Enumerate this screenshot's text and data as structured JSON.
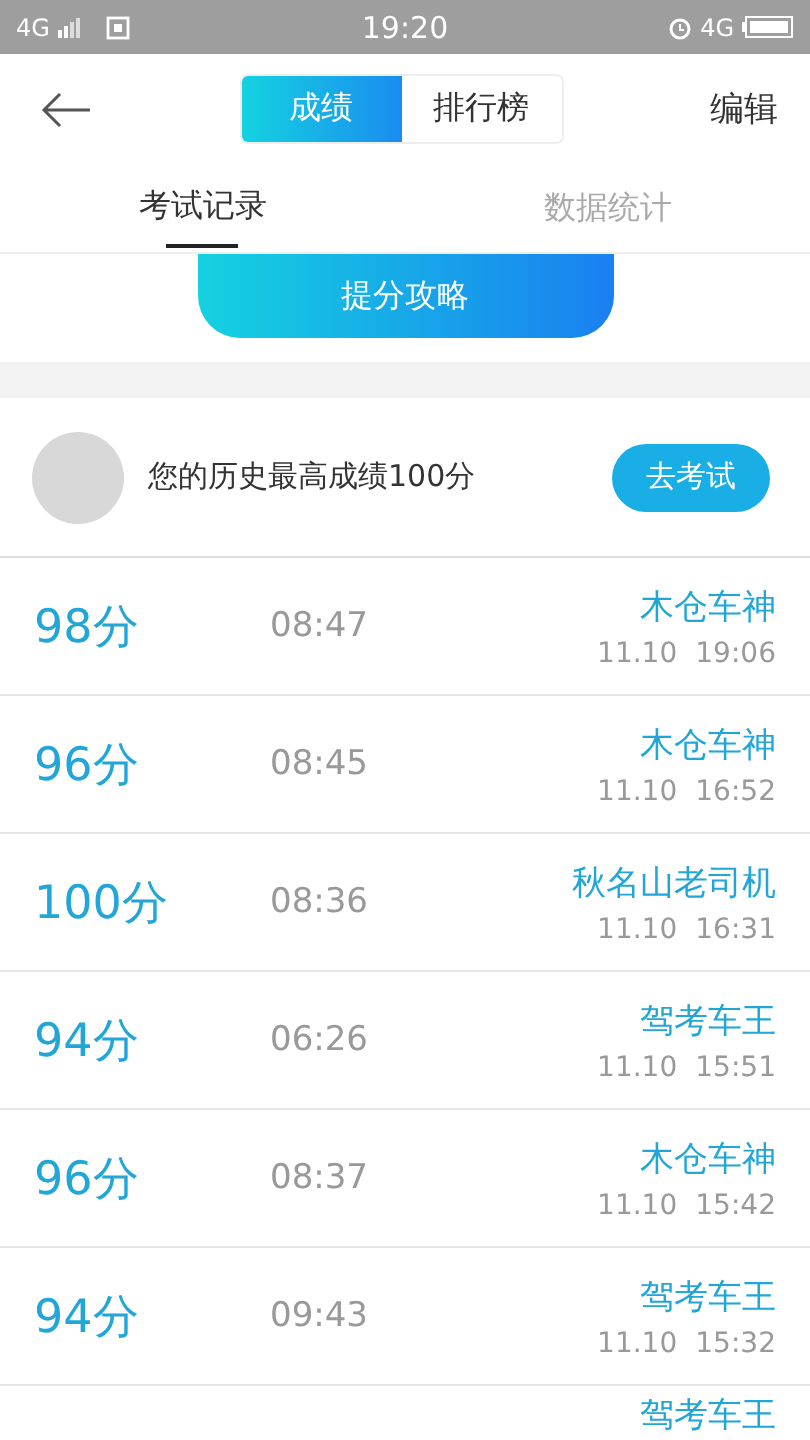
{
  "status_bar": {
    "network_left": "4G",
    "time": "19:20",
    "network_right": "4G"
  },
  "header": {
    "segments": [
      {
        "label": "成绩",
        "selected": true
      },
      {
        "label": "排行榜",
        "selected": false
      }
    ],
    "action": "编辑"
  },
  "tabs": [
    {
      "label": "考试记录",
      "selected": true
    },
    {
      "label": "数据统计",
      "selected": false
    }
  ],
  "tip_button": "提分攻略",
  "profile": {
    "text": "您的历史最高成绩100分",
    "button": "去考试"
  },
  "records": [
    {
      "score": "98分",
      "duration": "08:47",
      "name": "木仓车神",
      "date": "11.10",
      "time": "19:06"
    },
    {
      "score": "96分",
      "duration": "08:45",
      "name": "木仓车神",
      "date": "11.10",
      "time": "16:52"
    },
    {
      "score": "100分",
      "duration": "08:36",
      "name": "秋名山老司机",
      "date": "11.10",
      "time": "16:31"
    },
    {
      "score": "94分",
      "duration": "06:26",
      "name": "驾考车王",
      "date": "11.10",
      "time": "15:51"
    },
    {
      "score": "96分",
      "duration": "08:37",
      "name": "木仓车神",
      "date": "11.10",
      "time": "15:42"
    },
    {
      "score": "94分",
      "duration": "09:43",
      "name": "驾考车王",
      "date": "11.10",
      "time": "15:32"
    },
    {
      "name": "驾考车王"
    }
  ]
}
